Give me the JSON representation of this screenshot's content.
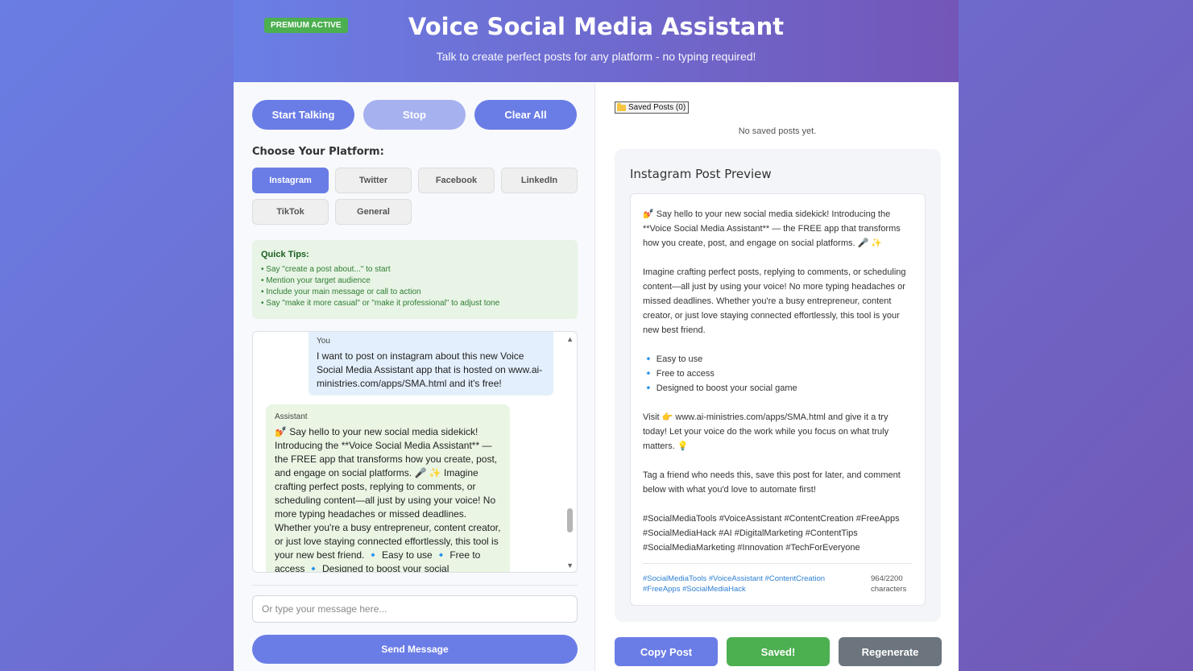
{
  "header": {
    "badge": "PREMIUM ACTIVE",
    "title": "Voice Social Media Assistant",
    "subtitle": "Talk to create perfect posts for any platform - no typing required!"
  },
  "controls": {
    "start": "Start Talking",
    "stop": "Stop",
    "clear": "Clear All"
  },
  "platforms": {
    "heading": "Choose Your Platform:",
    "items": [
      "Instagram",
      "Twitter",
      "Facebook",
      "LinkedIn",
      "TikTok",
      "General"
    ],
    "active": "Instagram"
  },
  "tips": {
    "title": "Quick Tips:",
    "items": [
      "• Say \"create a post about...\" to start",
      "• Mention your target audience",
      "• Include your main message or call to action",
      "• Say \"make it more casual\" or \"make it professional\" to adjust tone"
    ]
  },
  "chat": {
    "you_label": "You",
    "you_text": "I want to post on instagram about this new Voice Social Media Assistant app that is hosted on www.ai-ministries.com/apps/SMA.html and it's free!",
    "assistant_label": "Assistant",
    "assistant_text": "💅 Say hello to your new social media sidekick! Introducing the **Voice Social Media Assistant** — the FREE app that transforms how you create, post, and engage on social platforms. 🎤 ✨ Imagine crafting perfect posts, replying to comments, or scheduling content—all just by using your voice! No more typing headaches or missed deadlines. Whether you're a busy entrepreneur, content creator, or just love staying connected effortlessly, this tool is your new best friend. 🔹 Easy to use 🔹 Free to access 🔹 Designed to boost your social"
  },
  "input": {
    "placeholder": "Or type your message here...",
    "send": "Send Message"
  },
  "saved": {
    "toggle": "Saved Posts (0)",
    "empty": "No saved posts yet."
  },
  "preview": {
    "title": "Instagram Post Preview",
    "post": "💅 Say hello to your new social media sidekick! Introducing the **Voice Social Media Assistant** — the FREE app that transforms how you create, post, and engage on social platforms. 🎤 ✨\n\nImagine crafting perfect posts, replying to comments, or scheduling content—all just by using your voice! No more typing headaches or missed deadlines. Whether you're a busy entrepreneur, content creator, or just love staying connected effortlessly, this tool is your new best friend.\n\n🔹 Easy to use\n🔹 Free to access\n🔹 Designed to boost your social game\n\nVisit 👉 www.ai-ministries.com/apps/SMA.html and give it a try today! Let your voice do the work while you focus on what truly matters. 💡\n\nTag a friend who needs this, save this post for later, and comment below with what you'd love to automate first!\n\n#SocialMediaTools #VoiceAssistant #ContentCreation #FreeApps #SocialMediaHack #AI #DigitalMarketing #ContentTips #SocialMediaMarketing #Innovation #TechForEveryone",
    "tags": "#SocialMediaTools #VoiceAssistant #ContentCreation #FreeApps #SocialMediaHack",
    "count": "964/2200 characters"
  },
  "actions": {
    "copy": "Copy Post",
    "saved": "Saved!",
    "regenerate": "Regenerate"
  },
  "colors": {
    "accent": "#6a7de6",
    "success": "#4caf50",
    "neutral": "#6c757d"
  }
}
